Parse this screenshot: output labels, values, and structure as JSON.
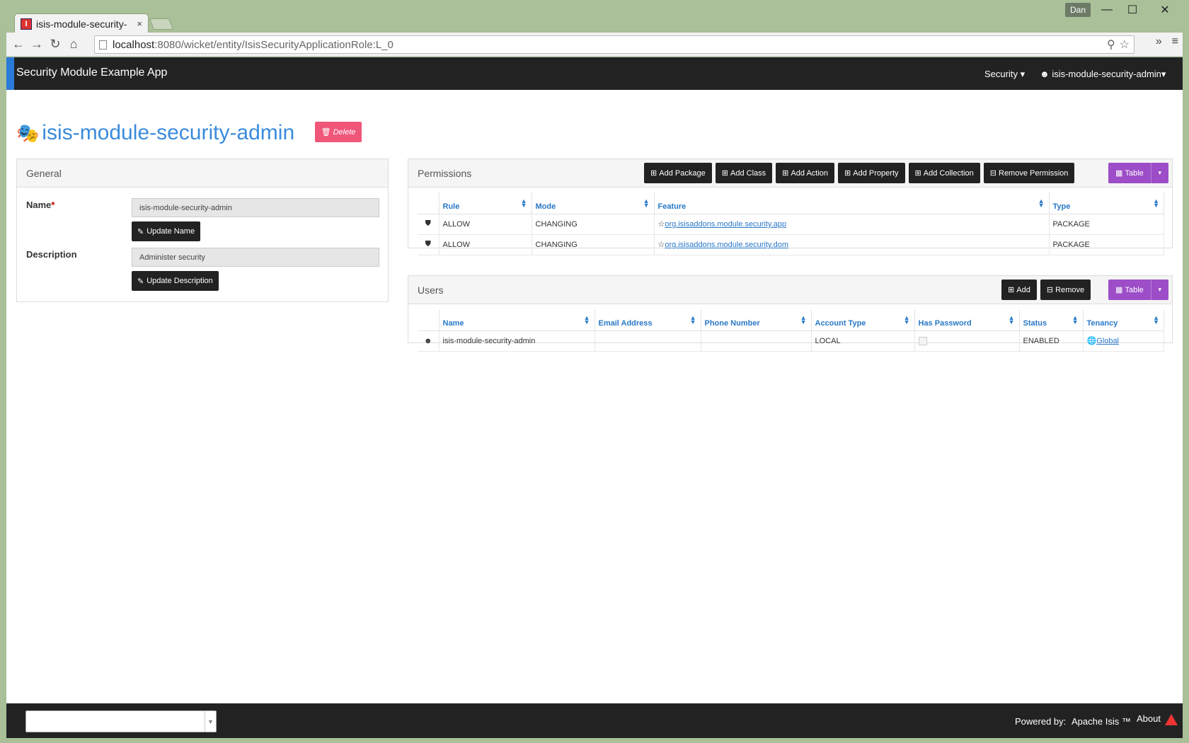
{
  "browser": {
    "tab_title": "isis-module-security-",
    "tab_close": "×",
    "favicon": "I",
    "user_badge": "Dan",
    "window_buttons": {
      "minimize": "—",
      "maximize": "☐",
      "close": "✕"
    },
    "url_host": "localhost",
    "url_rest": ":8080/wicket/entity/IsisSecurityApplicationRole:L_0",
    "nav_icons": [
      "back-arrow-icon",
      "forward-arrow-icon",
      "reload-icon",
      "home-icon"
    ],
    "back": "←",
    "forward": "→",
    "reload": "↻",
    "home": "⌂",
    "search_glyph": "⚲",
    "star_glyph": "☆",
    "more_glyph": "»",
    "menu_glyph": "≡"
  },
  "app": {
    "brand": "Security Module Example App",
    "menu_security": "Security",
    "menu_user": "isis-module-security-admin",
    "caret": "▾"
  },
  "entity": {
    "title": "isis-module-security-admin",
    "delete_label": "Delete"
  },
  "general": {
    "heading": "General",
    "name_label": "Name",
    "required_mark": "*",
    "name_value": "isis-module-security-admin",
    "update_name": "Update Name",
    "description_label": "Description",
    "description_value": "Administer security",
    "update_description": "Update Description"
  },
  "permissions": {
    "heading": "Permissions",
    "buttons": {
      "add_package": "Add Package",
      "add_class": "Add Class",
      "add_action": "Add Action",
      "add_property": "Add Property",
      "add_collection": "Add Collection",
      "remove_permission": "Remove Permission"
    },
    "view_label": "Table",
    "columns": [
      "Rule",
      "Mode",
      "Feature",
      "Type"
    ],
    "rows": [
      {
        "rule": "ALLOW",
        "mode": "CHANGING",
        "feature": "org.isisaddons.module.security.app",
        "type": "PACKAGE"
      },
      {
        "rule": "ALLOW",
        "mode": "CHANGING",
        "feature": "org.isisaddons.module.security.dom",
        "type": "PACKAGE"
      }
    ]
  },
  "users": {
    "heading": "Users",
    "add_label": "Add",
    "remove_label": "Remove",
    "view_label": "Table",
    "columns": [
      "Name",
      "Email Address",
      "Phone Number",
      "Account Type",
      "Has Password",
      "Status",
      "Tenancy"
    ],
    "rows": [
      {
        "name": "isis-module-security-admin",
        "email": "",
        "phone": "",
        "account_type": "LOCAL",
        "has_password": true,
        "status": "ENABLED",
        "tenancy": "Global"
      }
    ]
  },
  "footer": {
    "powered_by": "Powered by:",
    "product": "Apache Isis ™",
    "about": "About"
  },
  "colors": {
    "accent_blue": "#3a8bdc",
    "delete_pink": "#f0567a",
    "view_purple": "#9c4dc7",
    "nav_dark": "#222222"
  }
}
